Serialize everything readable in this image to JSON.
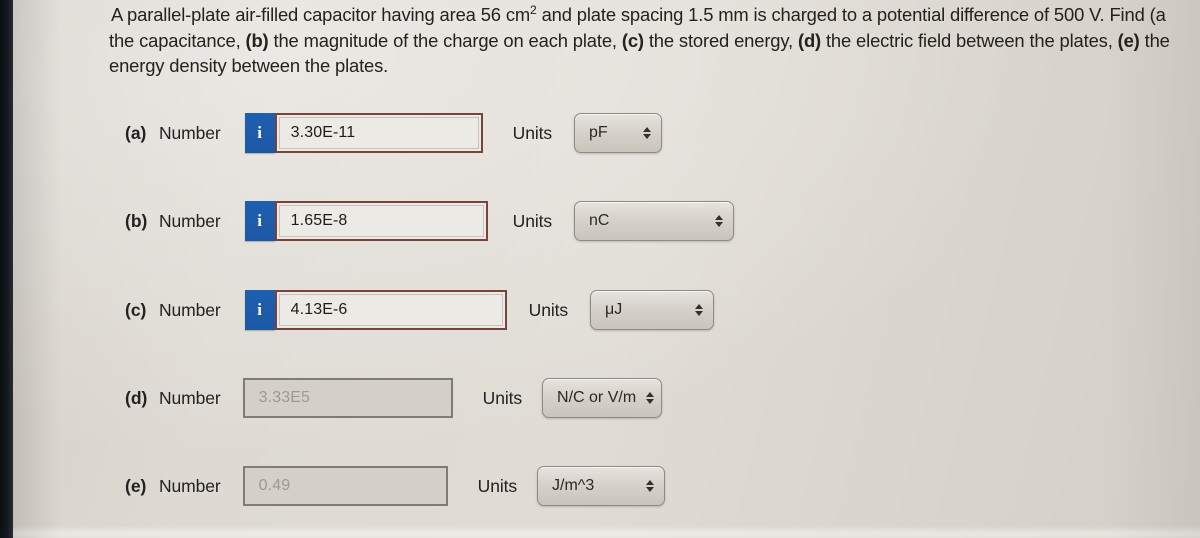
{
  "question": {
    "line1_pre": "A parallel-plate air-filled capacitor having area 56 cm",
    "line1_sup": "2",
    "line1_post": " and plate spacing 1.5 mm is charged to a potential difference of 500 V. Find (a",
    "line2_a": "the capacitance, ",
    "line2_b": "(b)",
    "line2_c": " the magnitude of the charge on each plate, ",
    "line2_d": "(c)",
    "line2_e": " the stored energy, ",
    "line2_f": "(d)",
    "line2_g": " the electric field between the plates, ",
    "line2_h": "(e)",
    "line2_i": " the",
    "line3": "energy density between the plates."
  },
  "labels": {
    "number": "Number",
    "units": "Units",
    "info_icon": "i"
  },
  "rows": [
    {
      "letter": "(a)",
      "value": "3.30E-11",
      "unit": "pF",
      "has_info": true,
      "active": true,
      "field_width": 208,
      "select_width": 88
    },
    {
      "letter": "(b)",
      "value": "1.65E-8",
      "unit": "nC",
      "has_info": true,
      "active": true,
      "field_width": 213,
      "select_width": 160
    },
    {
      "letter": "(c)",
      "value": "4.13E-6",
      "unit": "μJ",
      "has_info": true,
      "active": true,
      "field_width": 232,
      "select_width": 124
    },
    {
      "letter": "(d)",
      "value": "3.33E5",
      "unit": "N/C or V/m",
      "has_info": false,
      "active": false,
      "field_width": 210,
      "select_width": 120
    },
    {
      "letter": "(e)",
      "value": "0.49",
      "unit": "J/m^3",
      "has_info": false,
      "active": false,
      "field_width": 205,
      "select_width": 128
    }
  ],
  "colors": {
    "page_background": "#ded9d2",
    "info_icon_blue": "#1f5fb0",
    "active_field_border": "#79433c",
    "inactive_field_border": "#7d7c77",
    "text": "#23221f"
  }
}
